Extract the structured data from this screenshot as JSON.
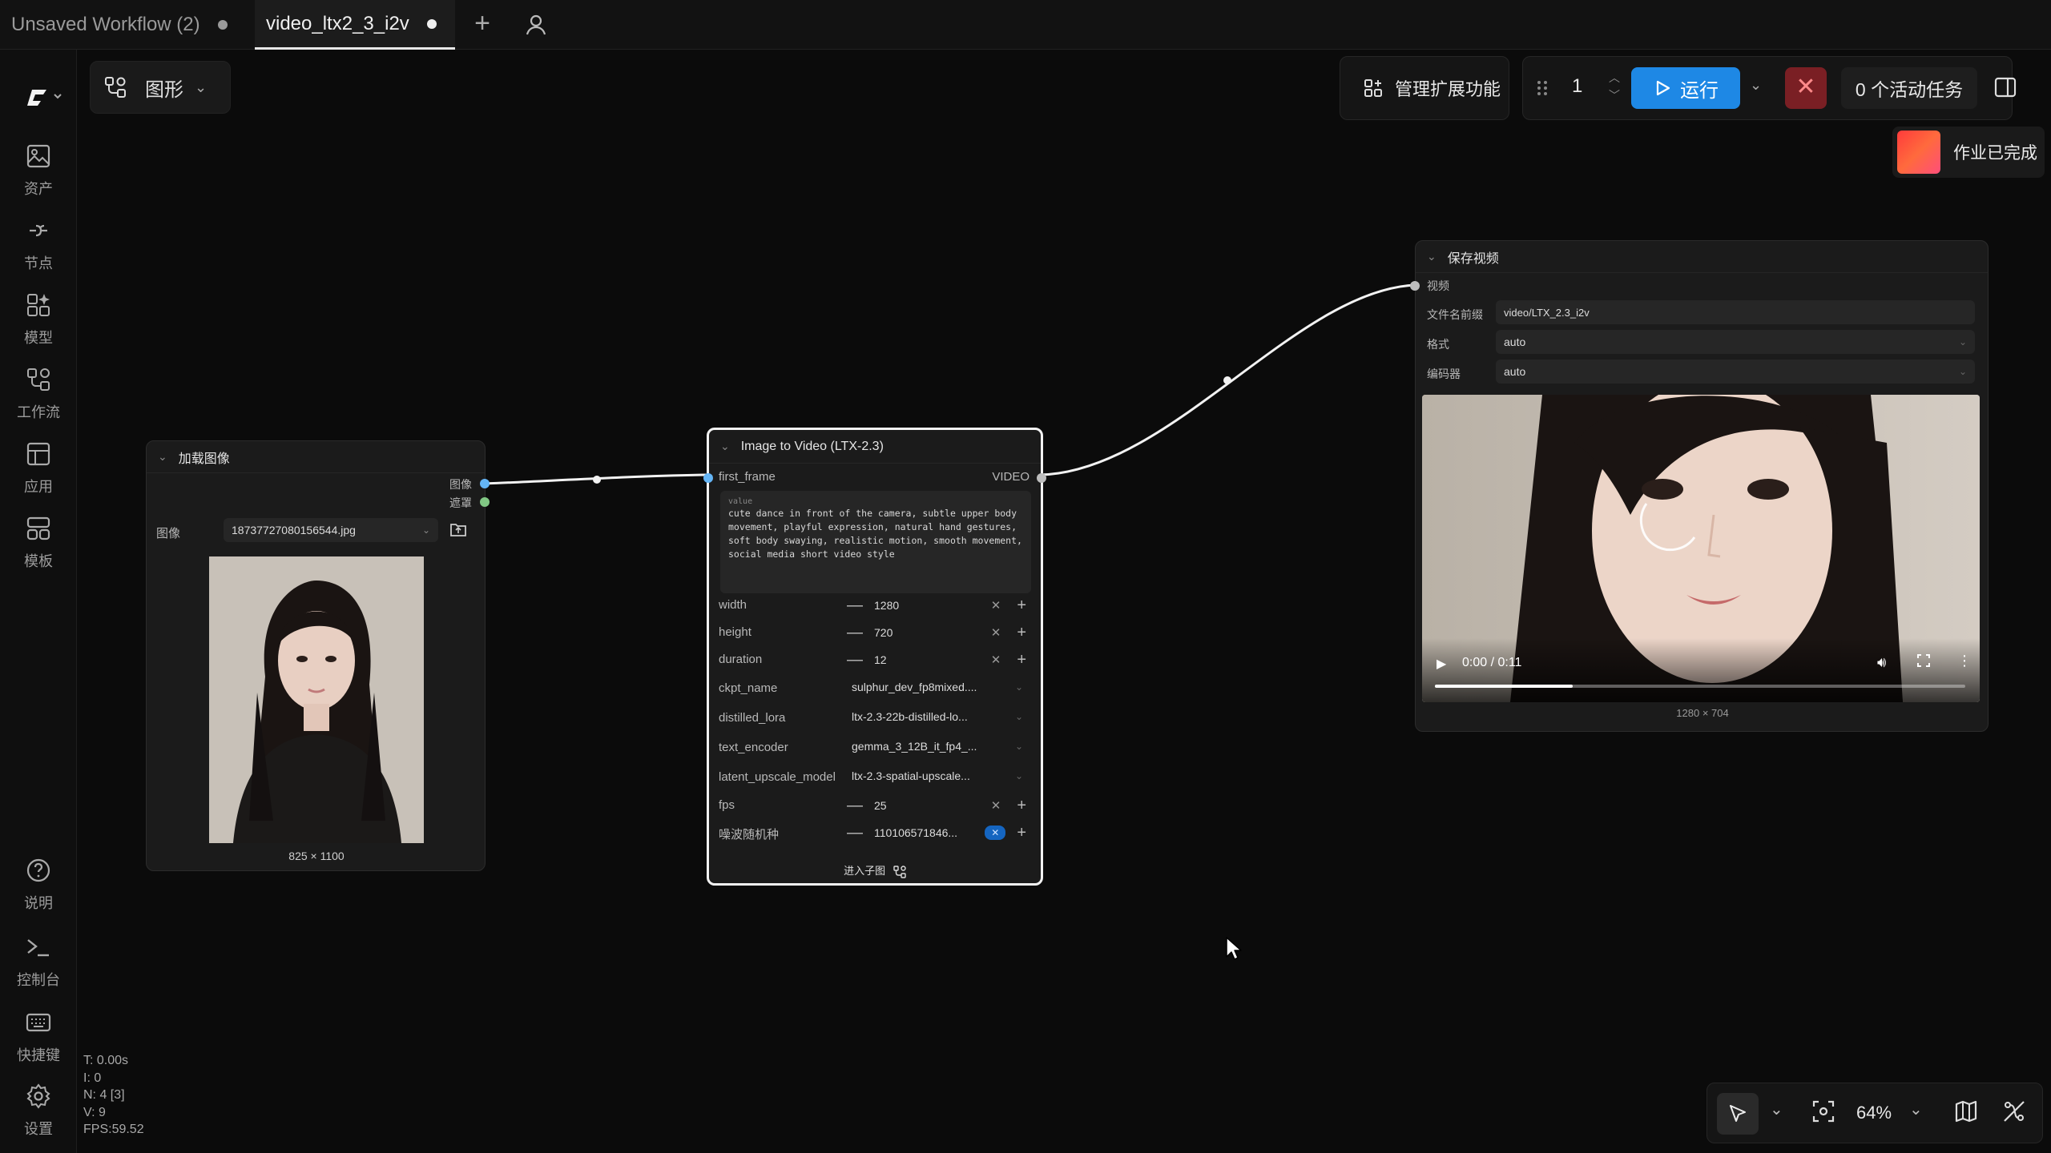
{
  "tabs": [
    {
      "label": "Unsaved Workflow (2)",
      "active": false
    },
    {
      "label": "video_ltx2_3_i2v",
      "active": true
    }
  ],
  "sidebar": {
    "items": [
      {
        "label": "资产",
        "icon": "image-icon"
      },
      {
        "label": "节点",
        "icon": "node-icon"
      },
      {
        "label": "模型",
        "icon": "models-icon"
      },
      {
        "label": "工作流",
        "icon": "workflow-icon"
      },
      {
        "label": "应用",
        "icon": "app-icon"
      },
      {
        "label": "模板",
        "icon": "template-icon"
      }
    ],
    "bottom": [
      {
        "label": "说明",
        "icon": "help-icon"
      },
      {
        "label": "控制台",
        "icon": "terminal-icon"
      },
      {
        "label": "快捷键",
        "icon": "keyboard-icon"
      },
      {
        "label": "设置",
        "icon": "settings-icon"
      }
    ]
  },
  "mode": {
    "label": "图形"
  },
  "toolbar": {
    "manage_extensions": "管理扩展功能",
    "queue_count": "1",
    "run_label": "运行",
    "active_tasks": "0 个活动任务"
  },
  "toast": {
    "label": "作业已完成"
  },
  "load_node": {
    "title": "加载图像",
    "out_image": "图像",
    "out_mask": "遮罩",
    "image_label": "图像",
    "filename": "18737727080156544.jpg",
    "dims": "825 × 1100"
  },
  "i2v_node": {
    "title": "Image to Video (LTX-2.3)",
    "input": "first_frame",
    "output": "VIDEO",
    "prompt_label": "value",
    "prompt": "cute dance in front of the camera, subtle upper body movement, playful expression, natural hand gestures, soft body swaying, realistic motion, smooth movement, social media short video style",
    "params": {
      "width": {
        "label": "width",
        "value": "1280"
      },
      "height": {
        "label": "height",
        "value": "720"
      },
      "duration": {
        "label": "duration",
        "value": "12"
      },
      "ckpt": {
        "label": "ckpt_name",
        "value": "sulphur_dev_fp8mixed...."
      },
      "lora": {
        "label": "distilled_lora",
        "value": "ltx-2.3-22b-distilled-lo..."
      },
      "encoder": {
        "label": "text_encoder",
        "value": "gemma_3_12B_it_fp4_..."
      },
      "upscale": {
        "label": "latent_upscale_model",
        "value": "ltx-2.3-spatial-upscale..."
      },
      "fps": {
        "label": "fps",
        "value": "25"
      },
      "seed": {
        "label": "噪波随机种",
        "value": "110106571846..."
      }
    },
    "subgraph": "进入子图"
  },
  "save_node": {
    "title": "保存视频",
    "input": "视频",
    "prefix_label": "文件名前缀",
    "prefix": "video/LTX_2.3_i2v",
    "format_label": "格式",
    "format": "auto",
    "codec_label": "编码器",
    "codec": "auto",
    "time": "0:00 / 0:11",
    "progress": 0.26,
    "dims": "1280 × 704"
  },
  "canvas": {
    "zoom": "64%"
  },
  "stats": {
    "t": "T: 0.00s",
    "i": "I: 0",
    "n": "N: 4 [3]",
    "v": "V: 9",
    "fps": "FPS:59.52"
  },
  "colors": {
    "accent": "#1e88e5",
    "port_image": "#64b5f6",
    "port_mask": "#81c784",
    "stop": "#7a1f24"
  }
}
